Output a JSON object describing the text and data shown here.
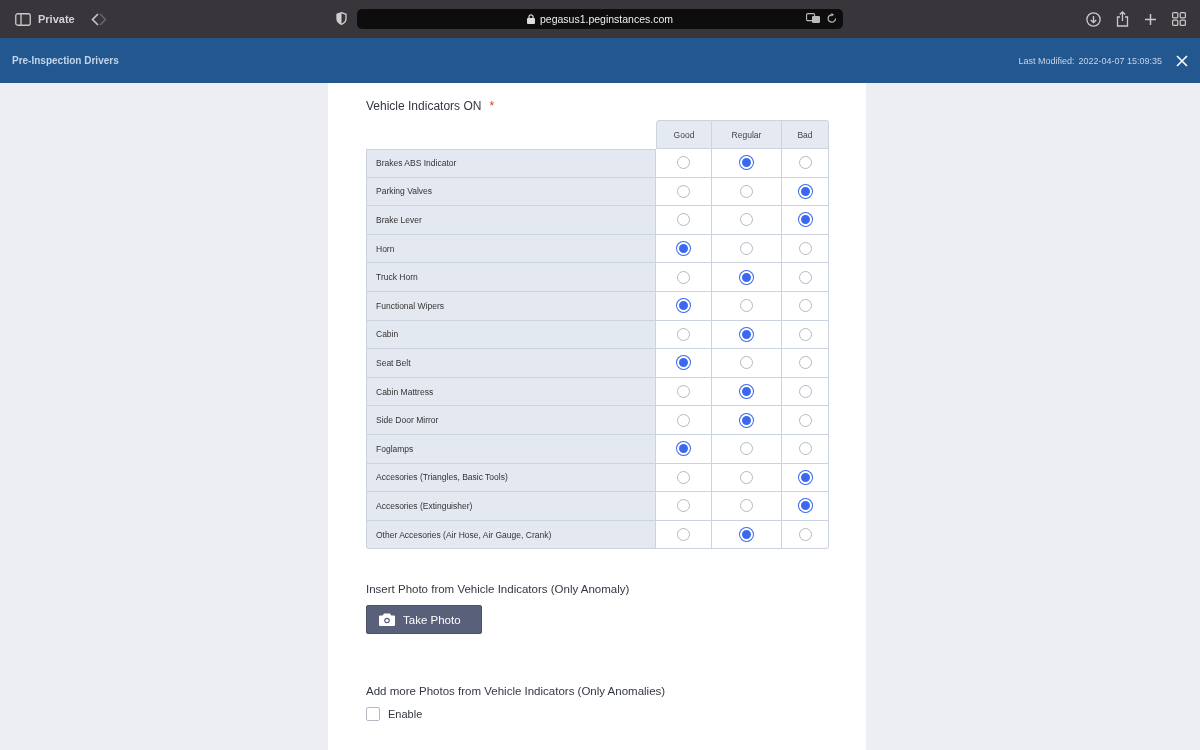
{
  "browser": {
    "mode_label": "Private",
    "url": "pegasus1.peginstances.com"
  },
  "header": {
    "title": "Pre-Inspection Drivers",
    "last_modified_label": "Last Modified:",
    "last_modified_value": "2022-04-07 15:09:35"
  },
  "question": {
    "label": "Vehicle Indicators ON",
    "required_mark": "*"
  },
  "table": {
    "columns": [
      "Good",
      "Regular",
      "Bad"
    ],
    "rows": [
      {
        "label": "Brakes ABS Indicator",
        "options": [
          false,
          true,
          false
        ]
      },
      {
        "label": "Parking Valves",
        "options": [
          false,
          false,
          true
        ]
      },
      {
        "label": "Brake Lever",
        "options": [
          false,
          false,
          true
        ]
      },
      {
        "label": "Horn",
        "options": [
          true,
          false,
          false
        ]
      },
      {
        "label": "Truck Horn",
        "options": [
          false,
          true,
          false
        ]
      },
      {
        "label": "Functional Wipers",
        "options": [
          true,
          false,
          false
        ]
      },
      {
        "label": "Cabin",
        "options": [
          false,
          true,
          false
        ]
      },
      {
        "label": "Seat Belt",
        "options": [
          true,
          false,
          false
        ]
      },
      {
        "label": "Cabin Mattress",
        "options": [
          false,
          true,
          false
        ]
      },
      {
        "label": "Side Door Mirror",
        "options": [
          false,
          true,
          false
        ]
      },
      {
        "label": "Foglamps",
        "options": [
          true,
          false,
          false
        ]
      },
      {
        "label": "Accesories (Triangles, Basic Tools)",
        "options": [
          false,
          false,
          true
        ]
      },
      {
        "label": "Accesories (Extinguisher)",
        "options": [
          false,
          false,
          true
        ]
      },
      {
        "label": "Other Accesories (Air Hose, Air Gauge, Crank)",
        "options": [
          false,
          true,
          false
        ]
      }
    ]
  },
  "photo": {
    "label": "Insert Photo from Vehicle Indicators (Only Anomaly)",
    "button": "Take Photo"
  },
  "more_photos": {
    "label": "Add more Photos from Vehicle Indicators (Only Anomalies)",
    "checkbox_label": "Enable",
    "checked": false
  }
}
